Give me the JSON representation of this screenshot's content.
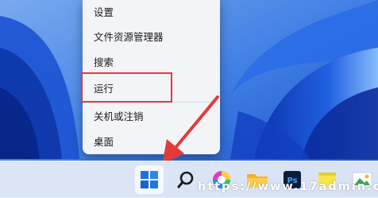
{
  "context_menu": {
    "items": [
      {
        "label": "设置"
      },
      {
        "label": "文件资源管理器"
      },
      {
        "label": "搜索"
      },
      {
        "label": "运行"
      },
      {
        "label": "关机或注销"
      },
      {
        "label": "桌面"
      }
    ]
  },
  "taskbar": {
    "apps": [
      {
        "icon": "windows-start-icon",
        "active": true
      },
      {
        "icon": "search-icon"
      },
      {
        "icon": "color-wheel-app-icon"
      },
      {
        "icon": "folder-icon"
      },
      {
        "icon": "photoshop-icon",
        "label": "Ps"
      },
      {
        "icon": "notes-app-icon"
      },
      {
        "icon": "photos-app-icon"
      }
    ]
  },
  "annotations": {
    "highlight_color": "#e23a3a",
    "arrow_color": "#e23a3a"
  },
  "watermark": {
    "text": "https://www.17admin.cc"
  }
}
